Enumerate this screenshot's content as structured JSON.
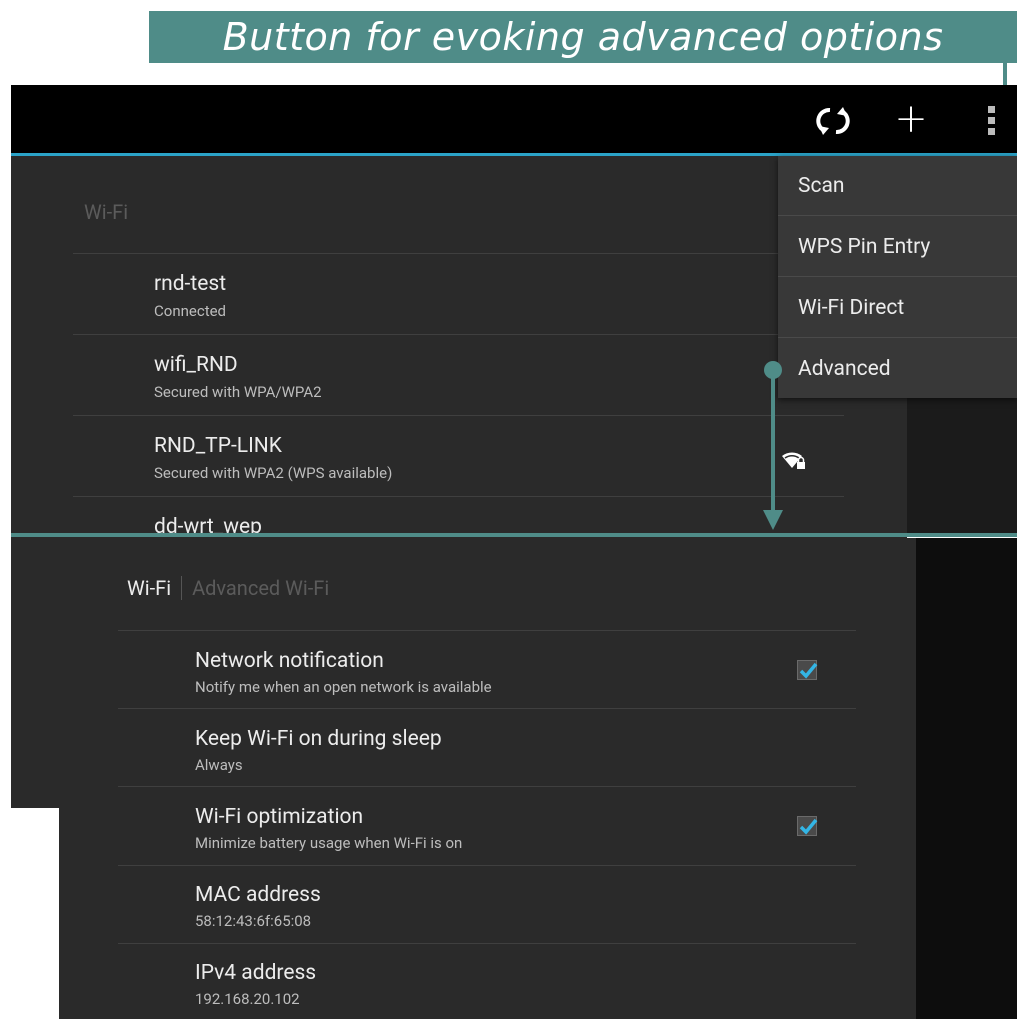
{
  "callout": {
    "text": "Button for evoking advanced options"
  },
  "actionbar": {
    "icons": [
      "refresh-icon",
      "add-icon",
      "overflow-menu-icon"
    ],
    "add_glyph": "+"
  },
  "wifi_list": {
    "section_title": "Wi-Fi",
    "networks": [
      {
        "name": "rnd-test",
        "status": "Connected"
      },
      {
        "name": "wifi_RND",
        "status": "Secured with WPA/WPA2"
      },
      {
        "name": "RND_TP-LINK",
        "status": "Secured with WPA2 (WPS available)"
      },
      {
        "name": "dd-wrt_wep",
        "status": ""
      }
    ]
  },
  "overflow_menu": {
    "items": [
      "Scan",
      "WPS Pin Entry",
      "Wi-Fi Direct",
      "Advanced"
    ]
  },
  "advanced": {
    "breadcrumb_root": "Wi-Fi",
    "breadcrumb_current": "Advanced Wi-Fi",
    "rows": [
      {
        "title": "Network notification",
        "summary": "Notify me when an open network is available",
        "checked": true
      },
      {
        "title": "Keep Wi-Fi on during sleep",
        "summary": "Always"
      },
      {
        "title": "Wi-Fi optimization",
        "summary": "Minimize battery usage when Wi-Fi is on",
        "checked": true
      },
      {
        "title": "MAC address",
        "summary": "58:12:43:6f:65:08"
      },
      {
        "title": "IPv4 address",
        "summary": "192.168.20.102"
      }
    ]
  },
  "colors": {
    "accent_teal": "#4f8c88",
    "holo_blue": "#2ba3c8",
    "check_blue": "#33b5e5"
  }
}
